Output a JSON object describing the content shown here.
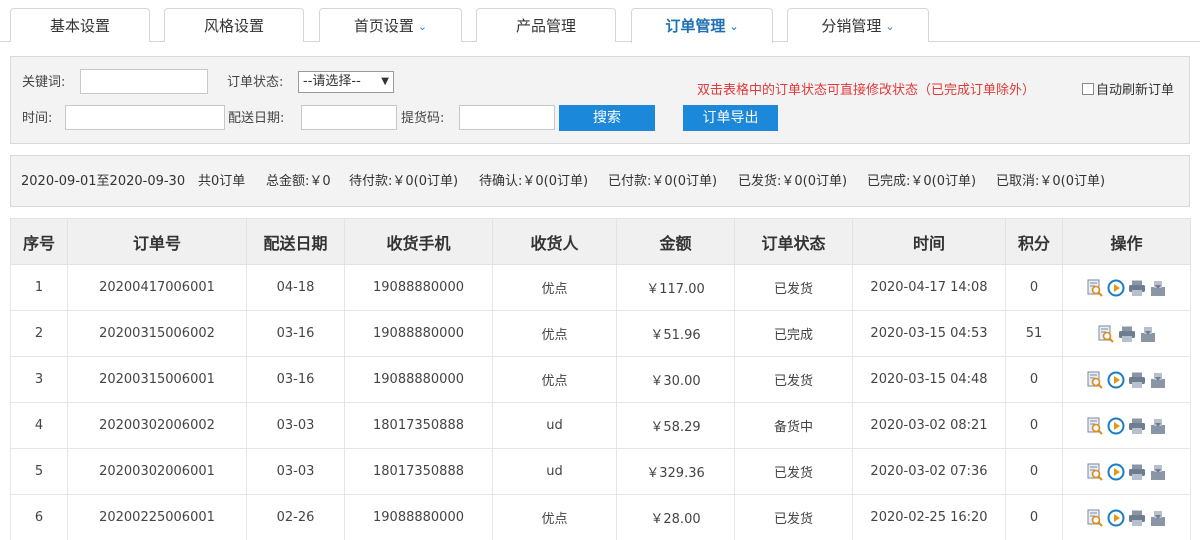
{
  "tabs": [
    {
      "label": "基本设置",
      "dropdown": false,
      "active": false
    },
    {
      "label": "风格设置",
      "dropdown": false,
      "active": false
    },
    {
      "label": "首页设置",
      "dropdown": true,
      "active": false
    },
    {
      "label": "产品管理",
      "dropdown": false,
      "active": false
    },
    {
      "label": "订单管理",
      "dropdown": true,
      "active": true
    },
    {
      "label": "分销管理",
      "dropdown": true,
      "active": false
    }
  ],
  "tab_chevron": "⌄",
  "filter": {
    "keyword_label": "关键词:",
    "keyword_value": "",
    "status_label": "订单状态:",
    "status_selected": "--请选择--",
    "status_arrow": "▼",
    "time_label": "时间:",
    "time_value": "",
    "delivery_label": "配送日期:",
    "delivery_value": "",
    "pickup_label": "提货码:",
    "pickup_value": "",
    "search_button": "搜索",
    "export_button": "订单导出",
    "notice": "双击表格中的订单状态可直接修改状态（已完成订单除外）",
    "auto_refresh_label": "自动刷新订单",
    "auto_refresh_checked": false
  },
  "summary": {
    "range": "2020-09-01至2020-09-30",
    "count": "共0订单",
    "total": "总金额:￥0",
    "pending_pay": "待付款:￥0(0订单)",
    "pending_confirm": "待确认:￥0(0订单)",
    "paid": "已付款:￥0(0订单)",
    "shipped": "已发货:￥0(0订单)",
    "completed": "已完成:￥0(0订单)",
    "cancelled": "已取消:￥0(0订单)"
  },
  "table": {
    "headers": [
      "序号",
      "订单号",
      "配送日期",
      "收货手机",
      "收货人",
      "金额",
      "订单状态",
      "时间",
      "积分",
      "操作"
    ],
    "rows": [
      {
        "no": "1",
        "order_no": "20200417006001",
        "delivery": "04-18",
        "phone": "19088880000",
        "receiver": "优点",
        "amount": "￥117.00",
        "status": "已发货",
        "time": "2020-04-17 14:08",
        "points": "0",
        "actions": [
          "view",
          "confirm",
          "print",
          "export"
        ]
      },
      {
        "no": "2",
        "order_no": "20200315006002",
        "delivery": "03-16",
        "phone": "19088880000",
        "receiver": "优点",
        "amount": "￥51.96",
        "status": "已完成",
        "time": "2020-03-15 04:53",
        "points": "51",
        "actions": [
          "view",
          "print",
          "export"
        ]
      },
      {
        "no": "3",
        "order_no": "20200315006001",
        "delivery": "03-16",
        "phone": "19088880000",
        "receiver": "优点",
        "amount": "￥30.00",
        "status": "已发货",
        "time": "2020-03-15 04:48",
        "points": "0",
        "actions": [
          "view",
          "confirm",
          "print",
          "export"
        ]
      },
      {
        "no": "4",
        "order_no": "20200302006002",
        "delivery": "03-03",
        "phone": "18017350888",
        "receiver": "ud",
        "amount": "￥58.29",
        "status": "备货中",
        "time": "2020-03-02 08:21",
        "points": "0",
        "actions": [
          "view",
          "confirm",
          "print",
          "export"
        ]
      },
      {
        "no": "5",
        "order_no": "20200302006001",
        "delivery": "03-03",
        "phone": "18017350888",
        "receiver": "ud",
        "amount": "￥329.36",
        "status": "已发货",
        "time": "2020-03-02 07:36",
        "points": "0",
        "actions": [
          "view",
          "confirm",
          "print",
          "export"
        ]
      },
      {
        "no": "6",
        "order_no": "20200225006001",
        "delivery": "02-26",
        "phone": "19088880000",
        "receiver": "优点",
        "amount": "￥28.00",
        "status": "已发货",
        "time": "2020-02-25 16:20",
        "points": "0",
        "actions": [
          "view",
          "confirm",
          "print",
          "export"
        ]
      }
    ]
  },
  "icons": {
    "view": "view-order-icon",
    "confirm": "process-order-icon",
    "print": "print-icon",
    "export": "export-order-icon"
  },
  "colors": {
    "accent": "#1b88d9",
    "active_tab": "#1f6fb2",
    "notice": "#e03a3a"
  }
}
